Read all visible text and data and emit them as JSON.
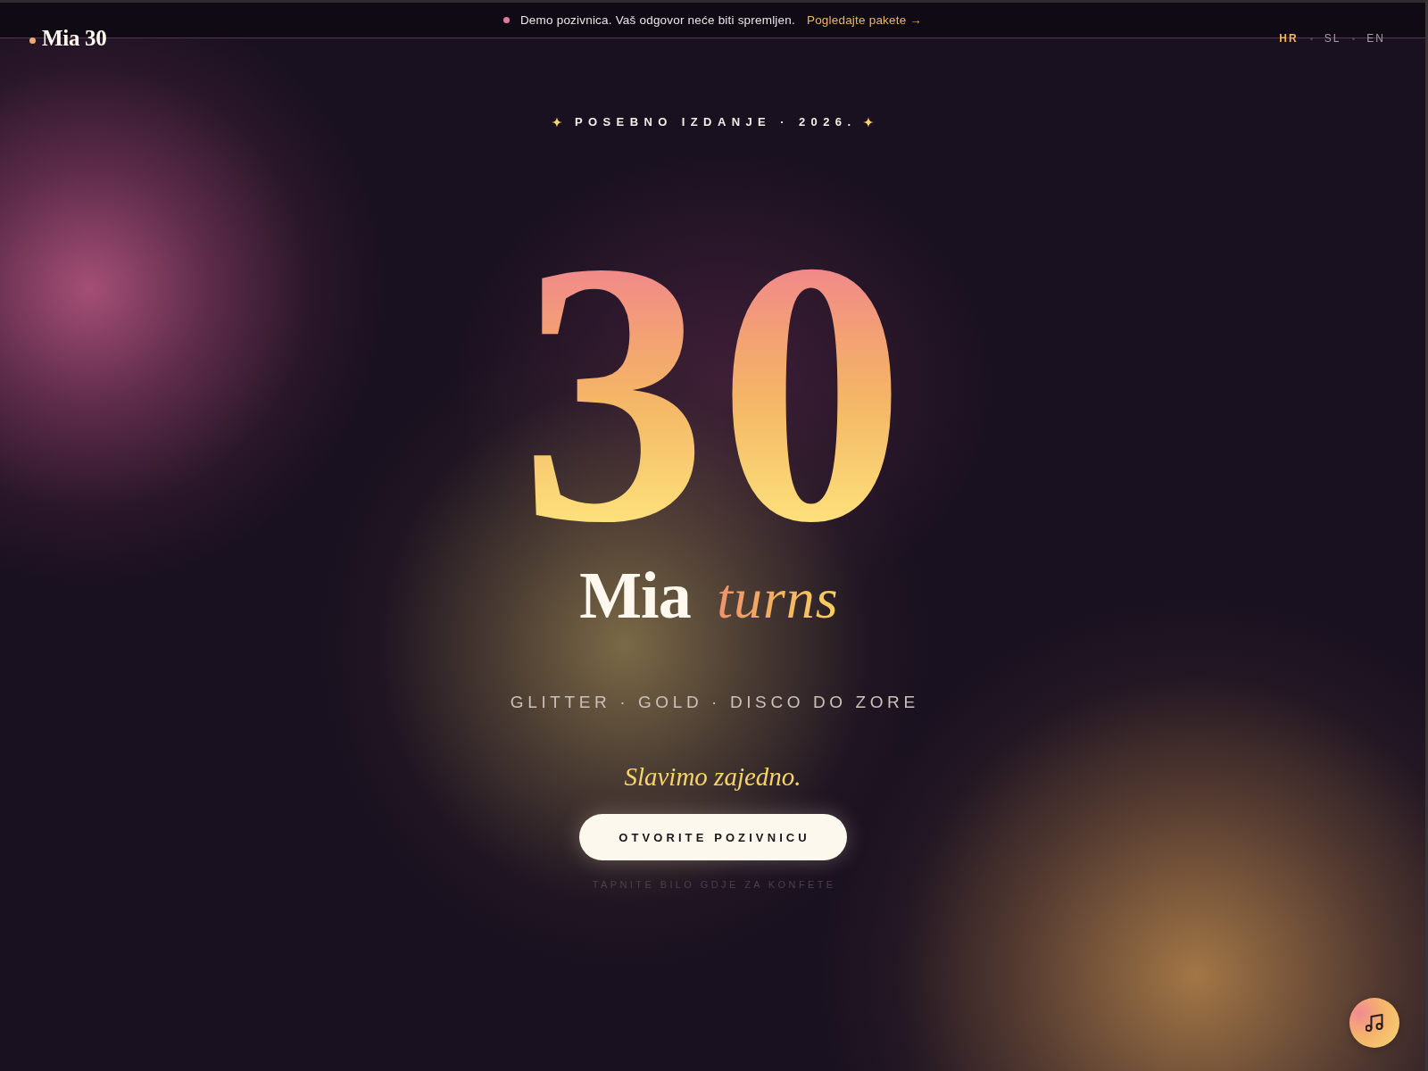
{
  "banner": {
    "text": "Demo pozivnica. Vaš odgovor neće biti spremljen.",
    "link": "Pogledajte pakete →"
  },
  "logo": {
    "text": "Mia 30"
  },
  "languages": [
    {
      "label": "HR",
      "selected": true
    },
    {
      "label": "SL",
      "selected": false
    },
    {
      "label": "EN",
      "selected": false
    }
  ],
  "hero": {
    "eyebrow": "POSEBNO IZDANJE · 2026.",
    "number": "30",
    "title": "Mia *turns*",
    "tagline": "GLITTER · GOLD · DISCO DO ZORE",
    "motto": "Slavimo zajedno.",
    "cta": "OTVORITE POZIVNICU",
    "hint": "TAPNITE BILO GDJE ZA KONFETE"
  }
}
